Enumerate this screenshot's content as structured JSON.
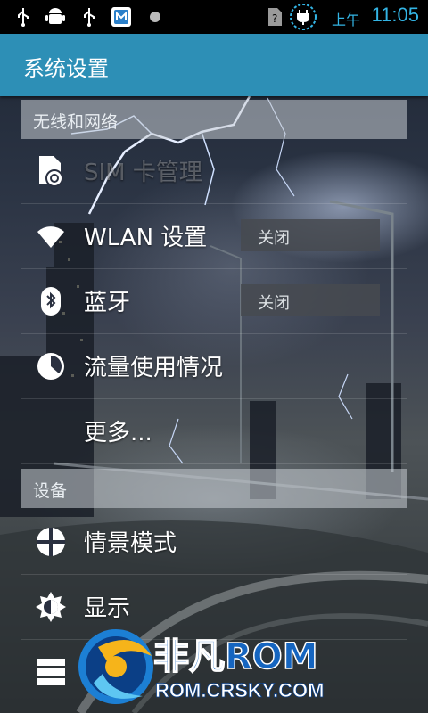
{
  "statusbar": {
    "ampm": "上午",
    "time": "11:05",
    "icons": [
      "usb-icon",
      "android-debug-icon",
      "usb-icon",
      "app-notification-icon",
      "moon-icon",
      "sim-unknown-icon",
      "charging-icon"
    ]
  },
  "header": {
    "title": "系统设置"
  },
  "sections": {
    "wireless": "无线和网络",
    "device": "设备"
  },
  "items": {
    "sim": {
      "label": "SIM 卡管理",
      "icon": "sim-card-icon"
    },
    "wlan": {
      "label": "WLAN 设置",
      "toggle": "关闭",
      "icon": "wifi-icon"
    },
    "bluetooth": {
      "label": "蓝牙",
      "toggle": "关闭",
      "icon": "bluetooth-icon"
    },
    "data_usage": {
      "label": "流量使用情况",
      "icon": "data-usage-icon"
    },
    "more": {
      "label": "更多...",
      "icon": ""
    },
    "profiles": {
      "label": "情景模式",
      "icon": "profiles-icon"
    },
    "display": {
      "label": "显示",
      "icon": "display-icon"
    },
    "storage": {
      "label": "",
      "icon": "storage-icon"
    }
  },
  "watermark": {
    "brand": "非凡ROM",
    "url": "ROM.CRSKY.COM"
  },
  "colors": {
    "accent": "#33b5e5",
    "titlebar": "#2d8fb6"
  }
}
